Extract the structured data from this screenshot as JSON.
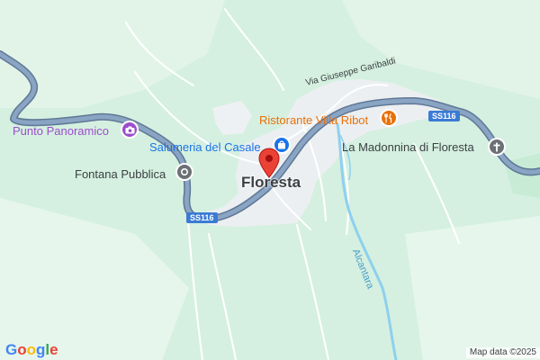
{
  "map": {
    "colors": {
      "background": "#d5f0e0",
      "terrain_light": "#e4f5ea",
      "urban": "#eceff1",
      "road_fill": "#7d98b8",
      "road_casing": "#5f7896",
      "local_road": "#ffffff",
      "river": "#8ed0ee",
      "pin": "#ea4335",
      "purple": "#9b4dcc",
      "orange": "#e8710a",
      "blue": "#1a73e8",
      "gray": "#5f6368"
    },
    "town": {
      "name": "Floresta"
    },
    "pois": [
      {
        "name": "Punto Panoramico",
        "icon": "camera-icon",
        "color": "#9b4dcc"
      },
      {
        "name": "Salumeria del Casale",
        "icon": "shopping-bag-icon",
        "color": "#1a73e8"
      },
      {
        "name": "Ristorante Villa Ribot",
        "icon": "restaurant-icon",
        "color": "#e8710a"
      },
      {
        "name": "Fontana Pubblica",
        "icon": "landmark-icon",
        "color": "#5f6368"
      },
      {
        "name": "La Madonnina di Floresta",
        "icon": "church-cross-icon",
        "color": "#5f6368"
      }
    ],
    "streets": {
      "via_garibaldi": "Via Giuseppe Garibaldi"
    },
    "route_shields": [
      "SS116",
      "SS116"
    ],
    "water": {
      "river": "Alcantara"
    },
    "attribution": "Map data ©2025",
    "logo": "Google"
  }
}
